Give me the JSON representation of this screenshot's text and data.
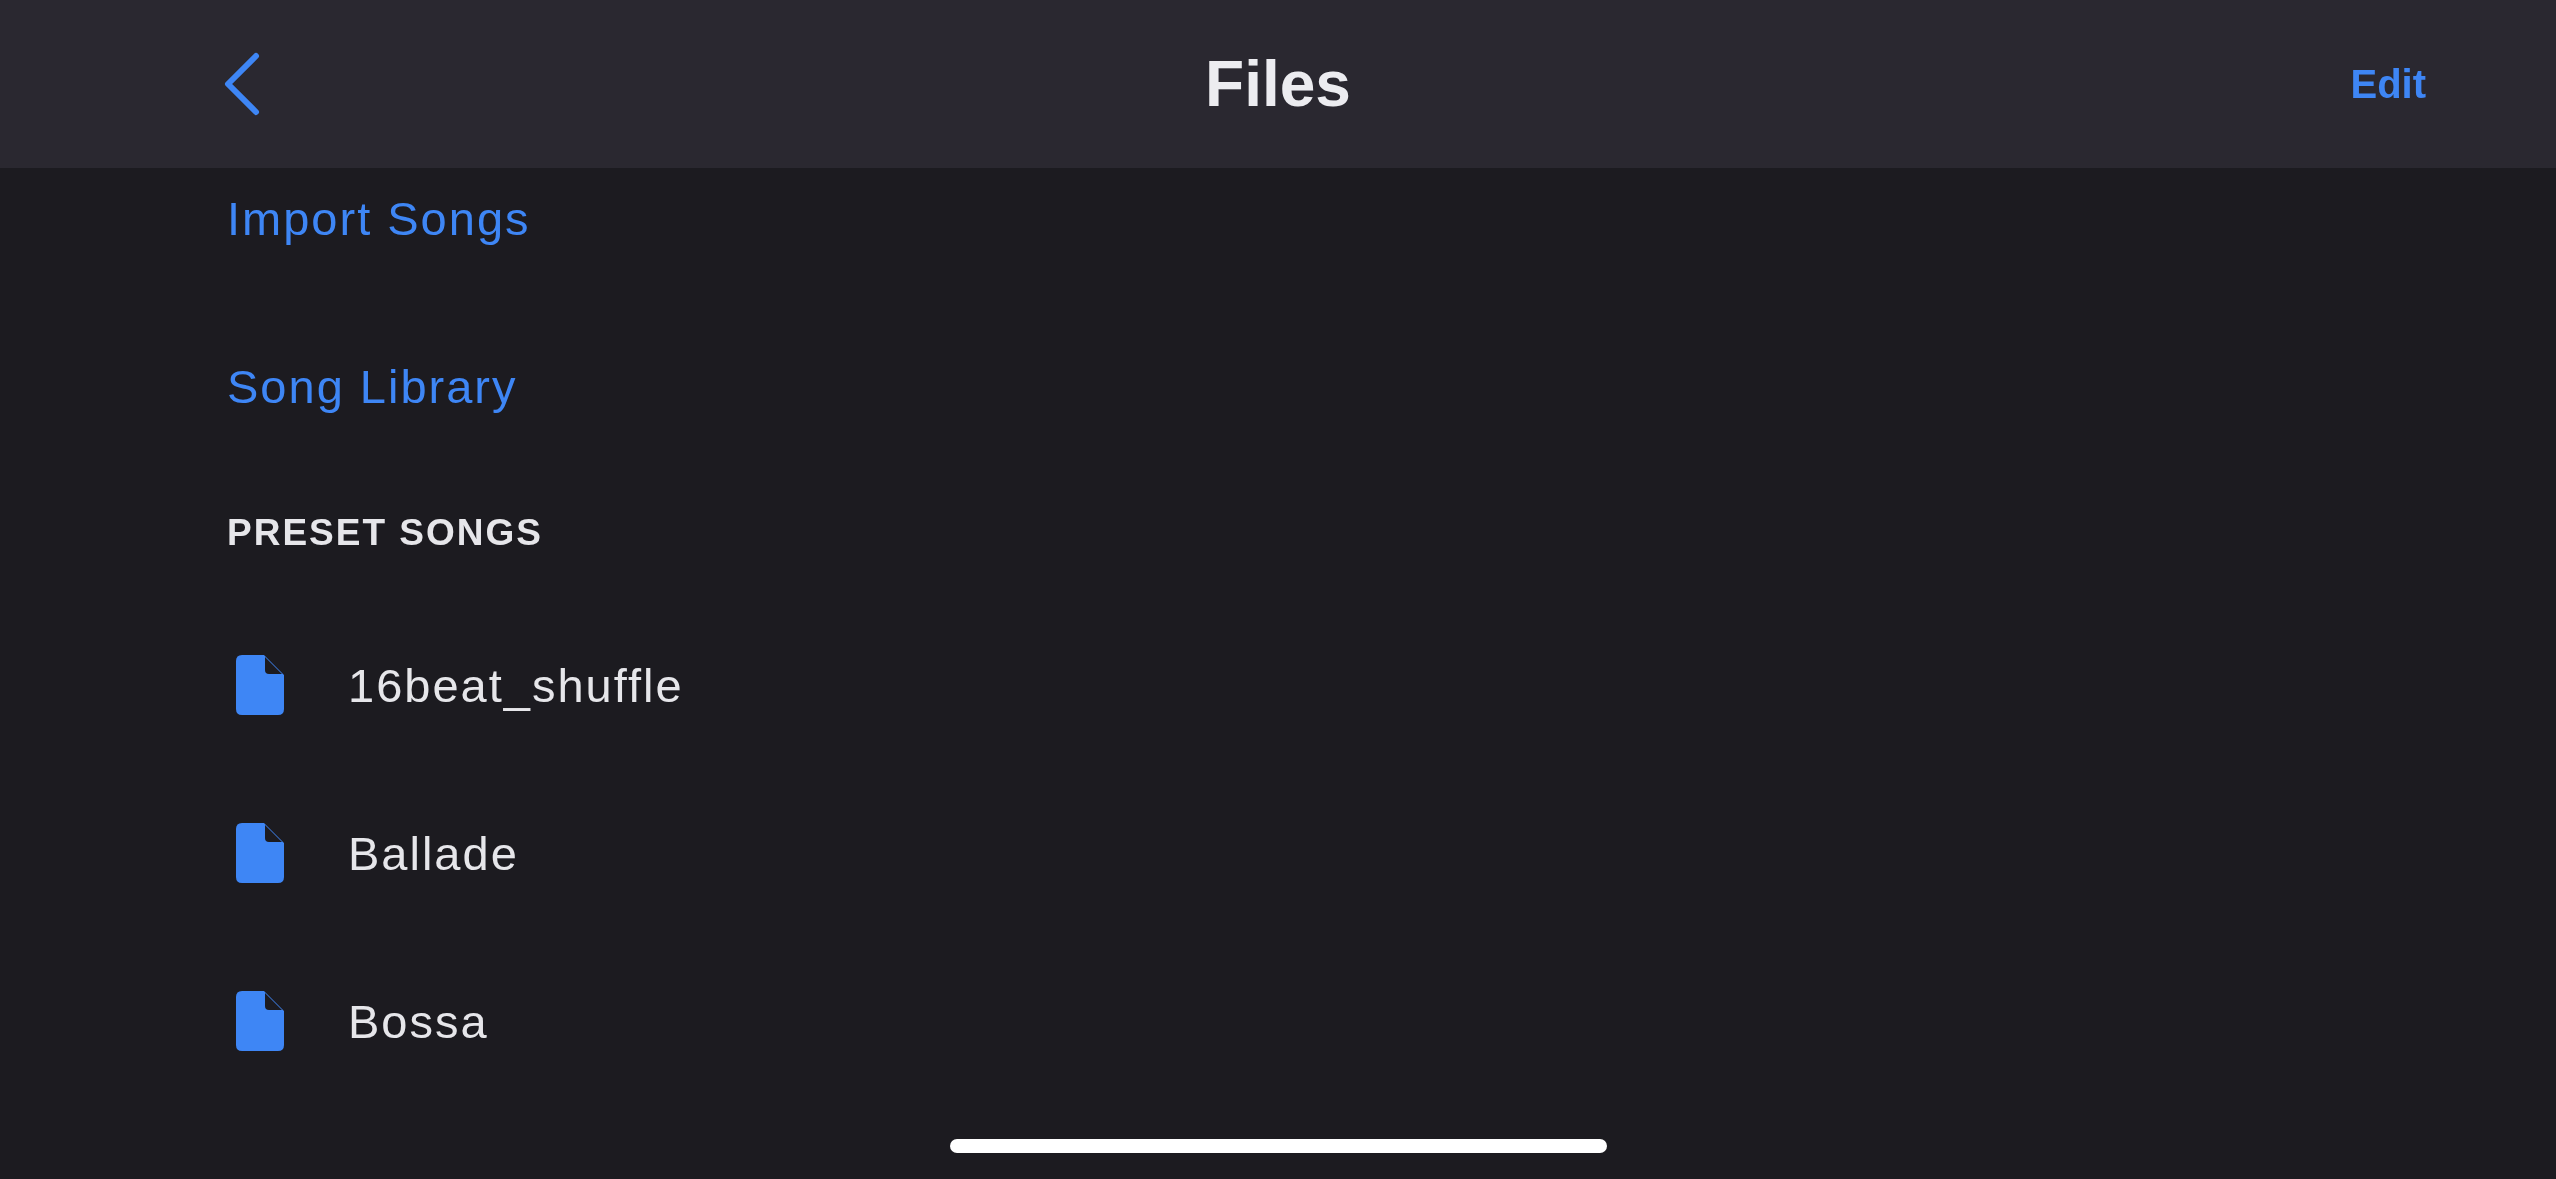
{
  "nav_bar": {
    "title": "Files",
    "edit": "Edit"
  },
  "links": [
    "Import Songs",
    "Song Library"
  ],
  "section": {
    "header": "PRESET SONGS",
    "files": [
      {
        "name": "16beat_shuffle"
      },
      {
        "name": "Ballade"
      },
      {
        "name": "Bossa"
      }
    ]
  }
}
